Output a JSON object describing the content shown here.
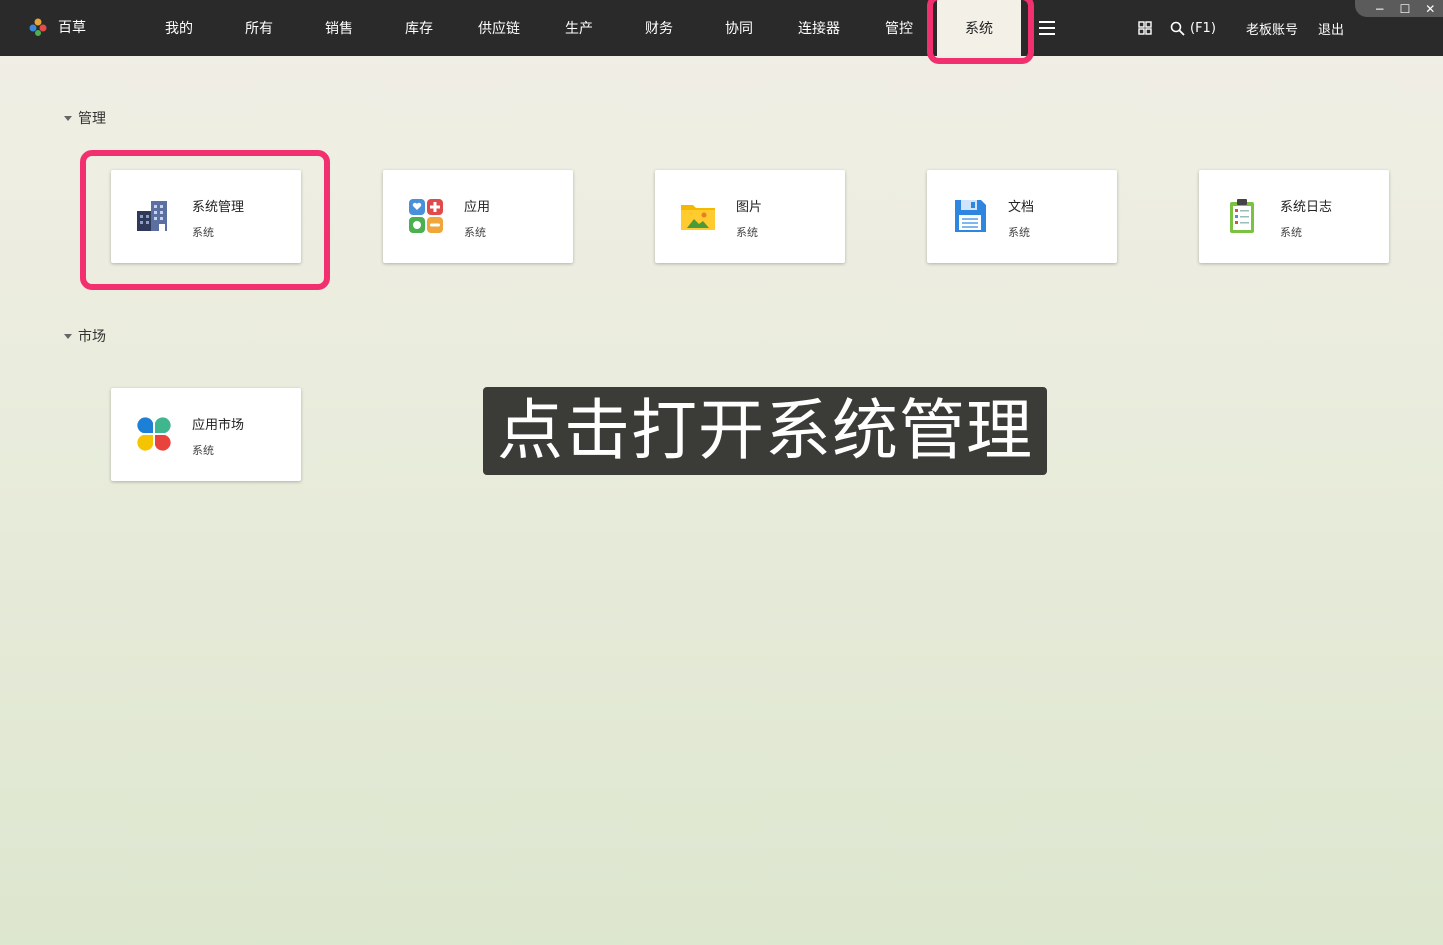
{
  "brand": {
    "name": "百草"
  },
  "nav": [
    {
      "label": "我的"
    },
    {
      "label": "所有"
    },
    {
      "label": "销售"
    },
    {
      "label": "库存"
    },
    {
      "label": "供应链"
    },
    {
      "label": "生产"
    },
    {
      "label": "财务"
    },
    {
      "label": "协同"
    },
    {
      "label": "连接器"
    },
    {
      "label": "管控"
    },
    {
      "label": "系统",
      "active": true
    }
  ],
  "toolbar": {
    "search_label": "(F1)",
    "account_label": "老板账号",
    "logout_label": "退出"
  },
  "window_controls": {
    "minimize": "−",
    "maximize": "☐",
    "close": "✕"
  },
  "sections": [
    {
      "title": "管理",
      "cards": [
        {
          "title": "系统管理",
          "sub": "系统",
          "icon": "building-icon"
        },
        {
          "title": "应用",
          "sub": "系统",
          "icon": "apps-grid-icon"
        },
        {
          "title": "图片",
          "sub": "系统",
          "icon": "image-folder-icon"
        },
        {
          "title": "文档",
          "sub": "系统",
          "icon": "floppy-disk-icon"
        },
        {
          "title": "系统日志",
          "sub": "系统",
          "icon": "clipboard-list-icon"
        }
      ]
    },
    {
      "title": "市场",
      "cards": [
        {
          "title": "应用市场",
          "sub": "系统",
          "icon": "clover-icon"
        }
      ]
    }
  ],
  "caption": "点击打开系统管理",
  "colors": {
    "topbar": "#2a2a2a",
    "highlight": "#f2306f",
    "active_tab": "#f3f0e8"
  }
}
